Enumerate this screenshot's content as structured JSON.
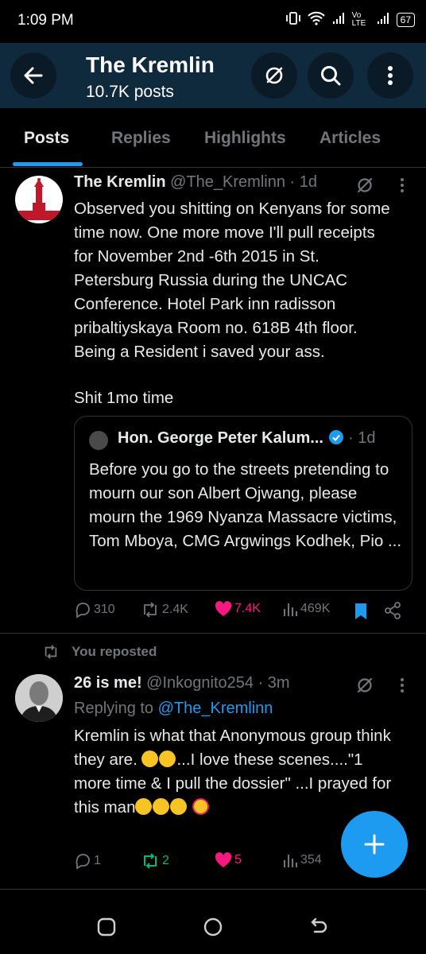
{
  "status": {
    "time": "1:09 PM",
    "network": "Vo LTE",
    "battery": "67"
  },
  "header": {
    "title": "The Kremlin",
    "posts_count": "10.7K posts"
  },
  "tabs": [
    {
      "label": "Posts"
    },
    {
      "label": "Replies"
    },
    {
      "label": "Highlights"
    },
    {
      "label": "Articles"
    }
  ],
  "post1": {
    "avatar_text": "KREMLIN",
    "name": "The Kremlin",
    "handle": "@The_Kremlinn",
    "time": "· 1d",
    "text": "Observed you shitting on Kenyans for some time now. One more move I'll pull receipts for November 2nd -6th 2015 in St. Petersburg Russia during the UNCAC Conference. Hotel Park inn radisson pribaltiyskaya Room no. 618B 4th floor. Being a Resident i saved your ass.",
    "text2": "Shit 1mo time",
    "quote": {
      "name": "Hon. George Peter Kalum...",
      "time": "· 1d",
      "text": "Before you go to the streets pretending to mourn our son Albert Ojwang, please mourn the 1969 Nyanza Massacre victims, Tom Mboya, CMG Argwings Kodhek, Pio ..."
    },
    "stats": {
      "replies": "310",
      "reposts": "2.4K",
      "likes": "7.4K",
      "views": "469K"
    }
  },
  "post2": {
    "repost_label": "You reposted",
    "name": "26 is me!",
    "handle": "@Inkognito254",
    "time": "· 3m",
    "replying_prefix": "Replying to",
    "replying_handle": "@The_Kremlinn",
    "text_part1": "Kremlin is what that Anonymous group think they are.",
    "text_part2": "...I love these scenes....\"1 more time & I pull the dossier\" ...I prayed for this man",
    "stats": {
      "replies": "1",
      "reposts": "2",
      "likes": "5",
      "views": "354"
    }
  },
  "colors": {
    "accent": "#1d9bf0",
    "like": "#f91880",
    "repost": "#00ba7c",
    "header_bg": "#0f2a3d"
  }
}
